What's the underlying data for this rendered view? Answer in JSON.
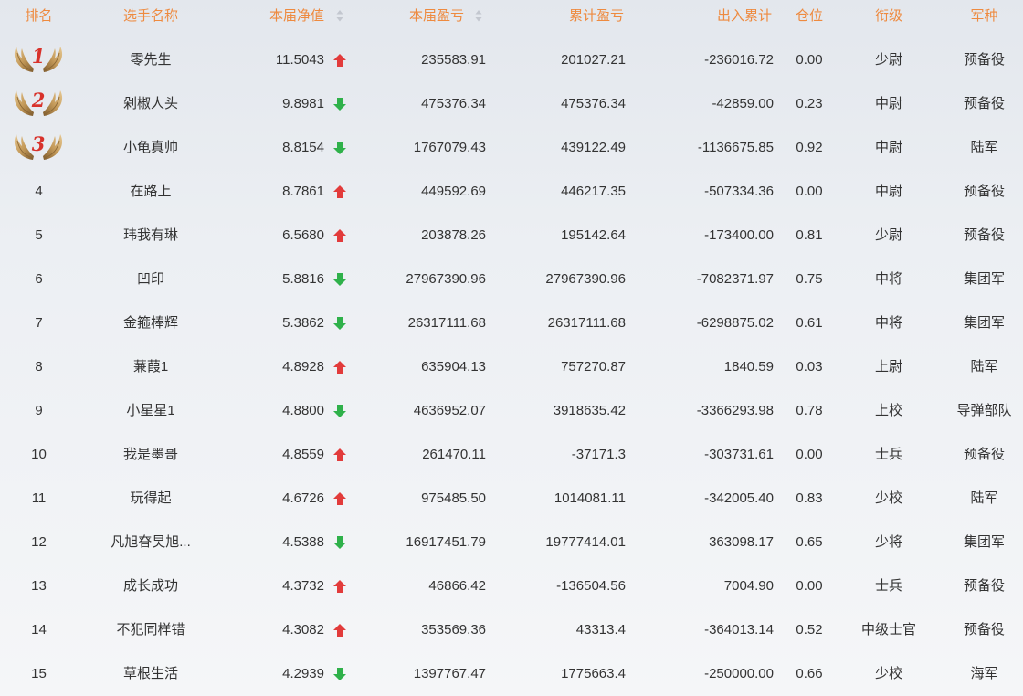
{
  "header": {
    "columns": {
      "rank": "排名",
      "name": "选手名称",
      "net_value": "本届净值",
      "profit": "本届盈亏",
      "cumulative_profit": "累计盈亏",
      "in_out_total": "出入累计",
      "position": "仓位",
      "title": "衔级",
      "branch": "军种"
    }
  },
  "colors": {
    "header_text": "#ee8a3f",
    "up_arrow": "#e23b3b",
    "down_arrow": "#2fb14a",
    "medal_number": "#d8322b",
    "laurel": "#c49a5a"
  },
  "icons": {
    "sort": "sort-icon",
    "up": "arrow-up-icon",
    "down": "arrow-down-icon",
    "medal": "laurel-icon"
  },
  "rows": [
    {
      "rank": "1",
      "name": "零先生",
      "net_value": "11.5043",
      "trend": "up",
      "profit": "235583.91",
      "cumulative_profit": "201027.21",
      "in_out_total": "-236016.72",
      "position": "0.00",
      "title": "少尉",
      "branch": "预备役"
    },
    {
      "rank": "2",
      "name": "剁椒人头",
      "net_value": "9.8981",
      "trend": "down",
      "profit": "475376.34",
      "cumulative_profit": "475376.34",
      "in_out_total": "-42859.00",
      "position": "0.23",
      "title": "中尉",
      "branch": "预备役"
    },
    {
      "rank": "3",
      "name": "小龟真帅",
      "net_value": "8.8154",
      "trend": "down",
      "profit": "1767079.43",
      "cumulative_profit": "439122.49",
      "in_out_total": "-1136675.85",
      "position": "0.92",
      "title": "中尉",
      "branch": "陆军"
    },
    {
      "rank": "4",
      "name": "在路上",
      "net_value": "8.7861",
      "trend": "up",
      "profit": "449592.69",
      "cumulative_profit": "446217.35",
      "in_out_total": "-507334.36",
      "position": "0.00",
      "title": "中尉",
      "branch": "预备役"
    },
    {
      "rank": "5",
      "name": "玮我有琳",
      "net_value": "6.5680",
      "trend": "up",
      "profit": "203878.26",
      "cumulative_profit": "195142.64",
      "in_out_total": "-173400.00",
      "position": "0.81",
      "title": "少尉",
      "branch": "预备役"
    },
    {
      "rank": "6",
      "name": "凹印",
      "net_value": "5.8816",
      "trend": "down",
      "profit": "27967390.96",
      "cumulative_profit": "27967390.96",
      "in_out_total": "-7082371.97",
      "position": "0.75",
      "title": "中将",
      "branch": "集团军"
    },
    {
      "rank": "7",
      "name": "金箍棒辉",
      "net_value": "5.3862",
      "trend": "down",
      "profit": "26317111.68",
      "cumulative_profit": "26317111.68",
      "in_out_total": "-6298875.02",
      "position": "0.61",
      "title": "中将",
      "branch": "集团军"
    },
    {
      "rank": "8",
      "name": "蒹葭1",
      "net_value": "4.8928",
      "trend": "up",
      "profit": "635904.13",
      "cumulative_profit": "757270.87",
      "in_out_total": "1840.59",
      "position": "0.03",
      "title": "上尉",
      "branch": "陆军"
    },
    {
      "rank": "9",
      "name": "小星星1",
      "net_value": "4.8800",
      "trend": "down",
      "profit": "4636952.07",
      "cumulative_profit": "3918635.42",
      "in_out_total": "-3366293.98",
      "position": "0.78",
      "title": "上校",
      "branch": "导弹部队"
    },
    {
      "rank": "10",
      "name": "我是墨哥",
      "net_value": "4.8559",
      "trend": "up",
      "profit": "261470.11",
      "cumulative_profit": "-37171.3",
      "in_out_total": "-303731.61",
      "position": "0.00",
      "title": "士兵",
      "branch": "预备役"
    },
    {
      "rank": "11",
      "name": "玩得起",
      "net_value": "4.6726",
      "trend": "up",
      "profit": "975485.50",
      "cumulative_profit": "1014081.11",
      "in_out_total": "-342005.40",
      "position": "0.83",
      "title": "少校",
      "branch": "陆军"
    },
    {
      "rank": "12",
      "name": "凡旭昚旲旭...",
      "net_value": "4.5388",
      "trend": "down",
      "profit": "16917451.79",
      "cumulative_profit": "19777414.01",
      "in_out_total": "363098.17",
      "position": "0.65",
      "title": "少将",
      "branch": "集团军"
    },
    {
      "rank": "13",
      "name": "成长成功",
      "net_value": "4.3732",
      "trend": "up",
      "profit": "46866.42",
      "cumulative_profit": "-136504.56",
      "in_out_total": "7004.90",
      "position": "0.00",
      "title": "士兵",
      "branch": "预备役"
    },
    {
      "rank": "14",
      "name": "不犯同样错",
      "net_value": "4.3082",
      "trend": "up",
      "profit": "353569.36",
      "cumulative_profit": "43313.4",
      "in_out_total": "-364013.14",
      "position": "0.52",
      "title": "中级士官",
      "branch": "预备役"
    },
    {
      "rank": "15",
      "name": "草根生活",
      "net_value": "4.2939",
      "trend": "down",
      "profit": "1397767.47",
      "cumulative_profit": "1775663.4",
      "in_out_total": "-250000.00",
      "position": "0.66",
      "title": "少校",
      "branch": "海军"
    }
  ]
}
